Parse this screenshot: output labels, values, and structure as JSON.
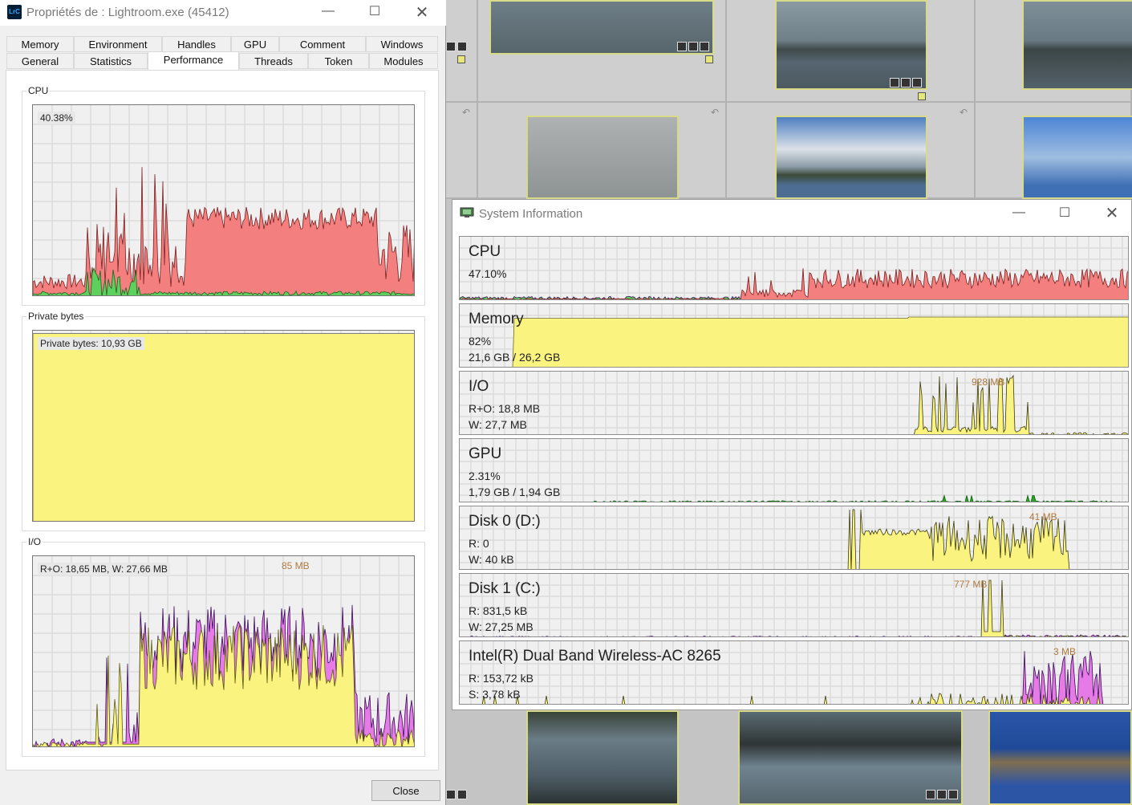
{
  "props_window": {
    "title": "Propriétés de : Lightroom.exe (45412)",
    "app_icon_text": "LrC",
    "tabs_row1": [
      "Memory",
      "Environment",
      "Handles",
      "GPU",
      "Comment",
      "Windows"
    ],
    "tabs_row2": [
      "General",
      "Statistics",
      "Performance",
      "Threads",
      "Token",
      "Modules"
    ],
    "active_tab": "Performance",
    "cpu": {
      "label": "CPU",
      "readout": "40.38%"
    },
    "private_bytes": {
      "label": "Private bytes",
      "readout": "Private bytes: 10,93 GB"
    },
    "io": {
      "label": "I/O",
      "readout": "R+O: 18,65 MB, W: 27,66 MB",
      "peak": "85 MB"
    },
    "close_label": "Close"
  },
  "sysinfo_window": {
    "title": "System Information",
    "rows": [
      {
        "name": "CPU",
        "line1": "47.10%",
        "line2": ""
      },
      {
        "name": "Memory",
        "line1": "82%",
        "line2": "21,6 GB / 26,2 GB"
      },
      {
        "name": "I/O",
        "line1": "R+O: 18,8 MB",
        "line2": "W: 27,7 MB",
        "peak": "928 MB"
      },
      {
        "name": "GPU",
        "line1": "2.31%",
        "line2": "1,79 GB / 1,94 GB"
      },
      {
        "name": "Disk 0 (D:)",
        "line1": "R: 0",
        "line2": "W: 40 kB",
        "peak": "41 MB"
      },
      {
        "name": "Disk 1 (C:)",
        "line1": "R: 831,5 kB",
        "line2": "W: 27,25 MB",
        "peak": "777 MB"
      },
      {
        "name": "Intel(R) Dual Band Wireless-AC 8265",
        "line1": "R: 153,72 kB",
        "line2": "S: 3,78 kB",
        "peak": "3 MB"
      }
    ]
  },
  "colors": {
    "cpu_fill": "#f47f7f",
    "cpu_kernel": "#5ed05e",
    "memory_fill": "#fbf37f",
    "io_fill": "#fbf37f",
    "io_write": "#e67ae6",
    "gpu_line": "#25a625"
  }
}
